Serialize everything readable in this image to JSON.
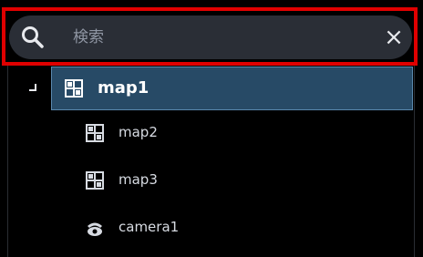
{
  "search": {
    "placeholder": "検索",
    "value": "",
    "clear_label": "×"
  },
  "tree": {
    "items": [
      {
        "label": "map1",
        "icon": "map-icon",
        "selected": true,
        "level": 0
      },
      {
        "label": "map2",
        "icon": "map-icon",
        "selected": false,
        "level": 1
      },
      {
        "label": "map3",
        "icon": "map-icon",
        "selected": false,
        "level": 1
      },
      {
        "label": "camera1",
        "icon": "camera-icon",
        "selected": false,
        "level": 1
      }
    ]
  },
  "colors": {
    "highlight_border": "#e00000",
    "search_bg": "#2a2e36",
    "selected_bg": "#274a66",
    "selected_border": "#5a88ad",
    "text": "#d7dbe2"
  }
}
